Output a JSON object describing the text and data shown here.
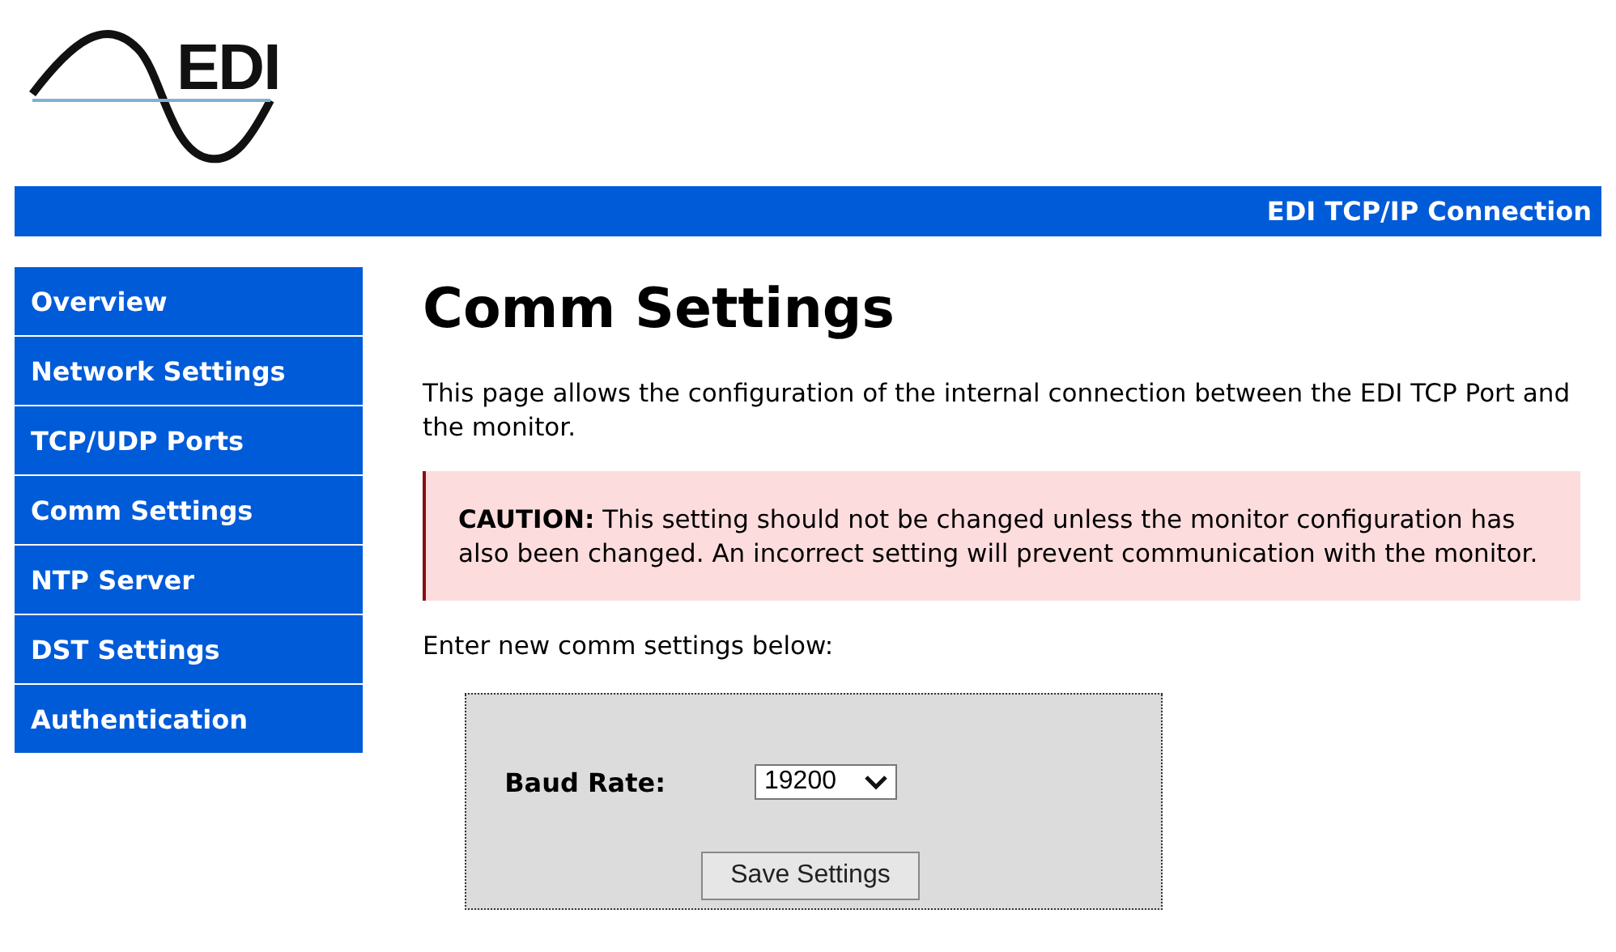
{
  "logo": {
    "text": "EDI"
  },
  "header_bar": {
    "title": "EDI TCP/IP Connection"
  },
  "sidebar": {
    "items": [
      {
        "label": "Overview"
      },
      {
        "label": "Network Settings"
      },
      {
        "label": "TCP/UDP Ports"
      },
      {
        "label": "Comm Settings"
      },
      {
        "label": "NTP Server"
      },
      {
        "label": "DST Settings"
      },
      {
        "label": "Authentication"
      }
    ]
  },
  "page": {
    "heading": "Comm Settings",
    "intro": "This page allows the configuration of the internal connection between the EDI TCP Port and the monitor.",
    "caution": "**CAUTION:** This setting should not be changed unless the monitor configuration has also been changed. An incorrect setting will prevent communication with the monitor.",
    "prompt": "Enter new comm settings below:",
    "form": {
      "baud_label": "Baud Rate:",
      "baud_value": "19200",
      "save_button": "Save Settings"
    }
  }
}
